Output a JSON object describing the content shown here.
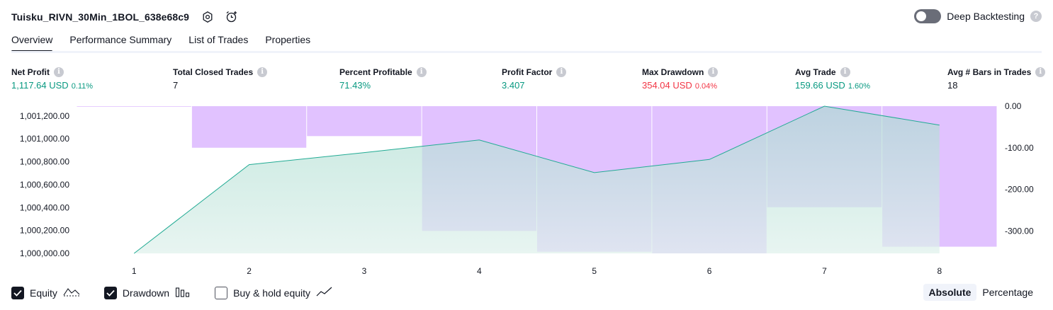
{
  "header": {
    "title": "Tuisku_RIVN_30Min_1BOL_638e68c9",
    "settings_icon": "settings-icon",
    "alert_icon": "add-alert-icon"
  },
  "deep_backtesting": {
    "label": "Deep Backtesting",
    "enabled": false,
    "help": "?"
  },
  "tabs": [
    {
      "label": "Overview",
      "active": true
    },
    {
      "label": "Performance Summary",
      "active": false
    },
    {
      "label": "List of Trades",
      "active": false
    },
    {
      "label": "Properties",
      "active": false
    }
  ],
  "metrics": [
    {
      "label": "Net Profit",
      "value": "1,117.64 USD",
      "pct": "0.11%",
      "color": "green"
    },
    {
      "label": "Total Closed Trades",
      "value": "7",
      "pct": "",
      "color": "dark"
    },
    {
      "label": "Percent Profitable",
      "value": "71.43%",
      "pct": "",
      "color": "green"
    },
    {
      "label": "Profit Factor",
      "value": "3.407",
      "pct": "",
      "color": "green"
    },
    {
      "label": "Max Drawdown",
      "value": "354.04 USD",
      "pct": "0.04%",
      "color": "red"
    },
    {
      "label": "Avg Trade",
      "value": "159.66 USD",
      "pct": "1.60%",
      "color": "green"
    },
    {
      "label": "Avg # Bars in Trades",
      "value": "18",
      "pct": "",
      "color": "dark"
    }
  ],
  "info_glyph": "i",
  "colors": {
    "green": "#089981",
    "red": "#f23645",
    "equity_line": "#22ab94",
    "drawdown": "#e1c2ff"
  },
  "chart_data": {
    "type": "area",
    "x": [
      1,
      2,
      3,
      4,
      5,
      6,
      7,
      8
    ],
    "series": [
      {
        "name": "Equity",
        "values": [
          1000000.0,
          1000775.0,
          1000880.0,
          1000990.0,
          1000705.0,
          1000820.0,
          1001285.0,
          1001120.0
        ]
      },
      {
        "name": "Drawdown",
        "values": [
          0.0,
          -100.0,
          -72.0,
          -300.0,
          -350.0,
          -354.04,
          -243.0,
          -338.0
        ]
      }
    ],
    "left_axis": {
      "ticks": [
        "1,000,000.00",
        "1,000,200.00",
        "1,000,400.00",
        "1,000,600.00",
        "1,000,800.00",
        "1,001,000.00",
        "1,001,200.00"
      ],
      "ylim": [
        1000000,
        1001285
      ]
    },
    "right_axis": {
      "ticks": [
        "0.00",
        "-100.00",
        "-200.00",
        "-300.00"
      ],
      "ylim": [
        -354.04,
        0
      ]
    },
    "x_ticks": [
      "1",
      "2",
      "3",
      "4",
      "5",
      "6",
      "7",
      "8"
    ]
  },
  "legend": [
    {
      "label": "Equity",
      "checked": true,
      "icon": "equity-line-icon"
    },
    {
      "label": "Drawdown",
      "checked": true,
      "icon": "drawdown-bars-icon"
    },
    {
      "label": "Buy & hold equity",
      "checked": false,
      "icon": "buy-hold-line-icon"
    }
  ],
  "mode": {
    "absolute": "Absolute",
    "percentage": "Percentage",
    "selected": "Absolute"
  }
}
